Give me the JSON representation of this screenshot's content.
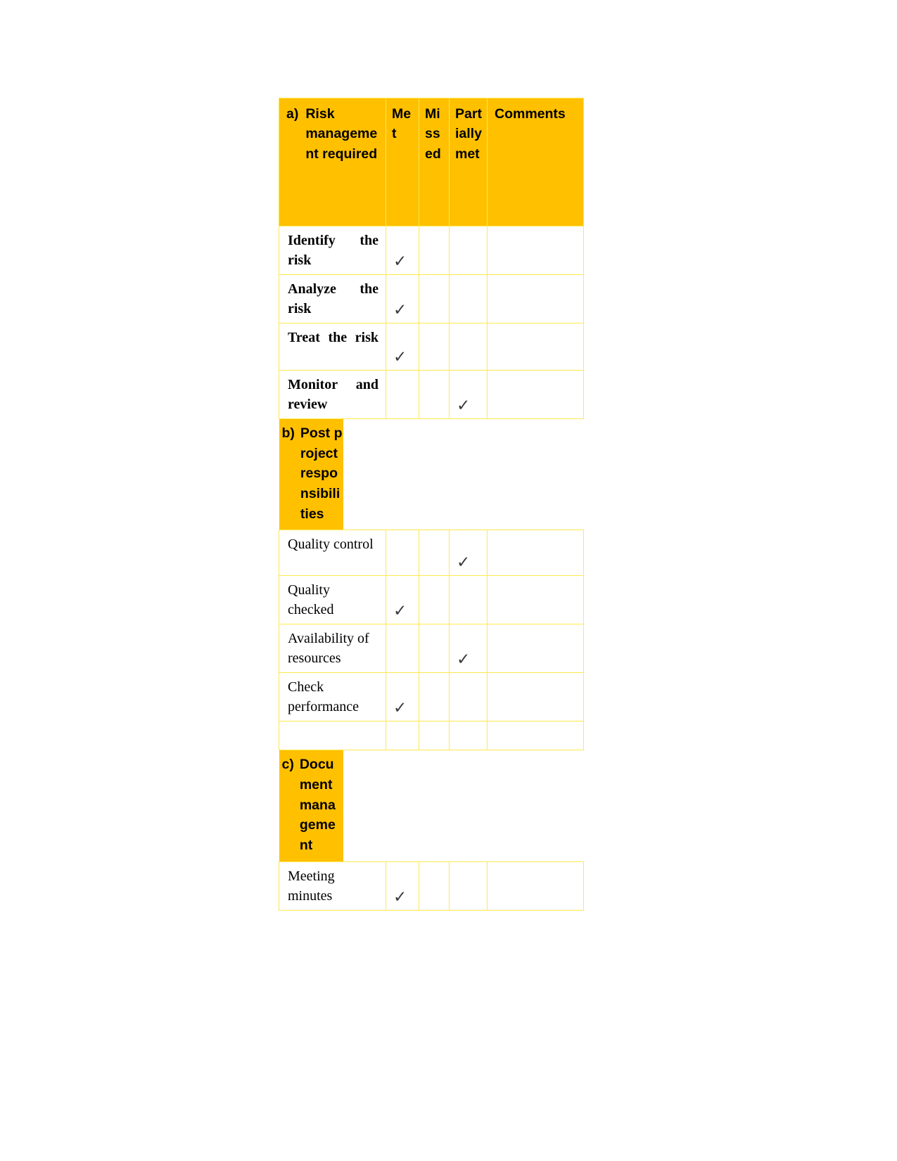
{
  "document": {
    "type": "project-closure-checklist",
    "colors": {
      "header_fill": "#FFC000",
      "border": "#FFE84D",
      "text": "#000000",
      "tick": "#3A3A3A",
      "page_background": "#FFFFFF"
    }
  },
  "table": {
    "columns": [
      {
        "key": "task",
        "label": ""
      },
      {
        "key": "met",
        "label": "Met"
      },
      {
        "key": "missed",
        "label": "Missed"
      },
      {
        "key": "partial",
        "label": "Partially met"
      },
      {
        "key": "comments",
        "label": "Comments"
      }
    ],
    "header": {
      "marker": "a)",
      "title": "Risk management required",
      "met": "Met",
      "missed": "Missed",
      "partially_met": "Partially met",
      "comments": "Comments"
    },
    "tick_glyph": "✓",
    "sections": [
      {
        "id": "a",
        "marker": "a)",
        "title": "Risk management required",
        "is_table_header": true,
        "rows": [
          {
            "task": "Identify the risk",
            "bold": true,
            "met": true,
            "missed": false,
            "partial": false,
            "comments": ""
          },
          {
            "task": "Analyze the risk",
            "bold": true,
            "met": true,
            "missed": false,
            "partial": false,
            "comments": ""
          },
          {
            "task": "Treat the risk",
            "bold": true,
            "met": true,
            "missed": false,
            "partial": false,
            "comments": ""
          },
          {
            "task": "Monitor and review",
            "bold": true,
            "met": false,
            "missed": false,
            "partial": true,
            "comments": ""
          }
        ]
      },
      {
        "id": "b",
        "marker": "b)",
        "title": "Post project responsibilities",
        "is_table_header": false,
        "rows": [
          {
            "task": "Quality control",
            "bold": false,
            "met": false,
            "missed": false,
            "partial": true,
            "comments": ""
          },
          {
            "task": "Quality checked",
            "bold": false,
            "met": true,
            "missed": false,
            "partial": false,
            "comments": ""
          },
          {
            "task": "Availability of resources",
            "bold": false,
            "met": false,
            "missed": false,
            "partial": true,
            "comments": ""
          },
          {
            "task": "Check performance",
            "bold": false,
            "met": true,
            "missed": false,
            "partial": false,
            "comments": ""
          },
          {
            "task": "",
            "bold": false,
            "met": false,
            "missed": false,
            "partial": false,
            "comments": ""
          }
        ]
      },
      {
        "id": "c",
        "marker": "c)",
        "title": "Document management",
        "is_table_header": false,
        "rows": [
          {
            "task": "Meeting minutes",
            "bold": false,
            "met": true,
            "missed": false,
            "partial": false,
            "comments": ""
          }
        ]
      }
    ]
  }
}
